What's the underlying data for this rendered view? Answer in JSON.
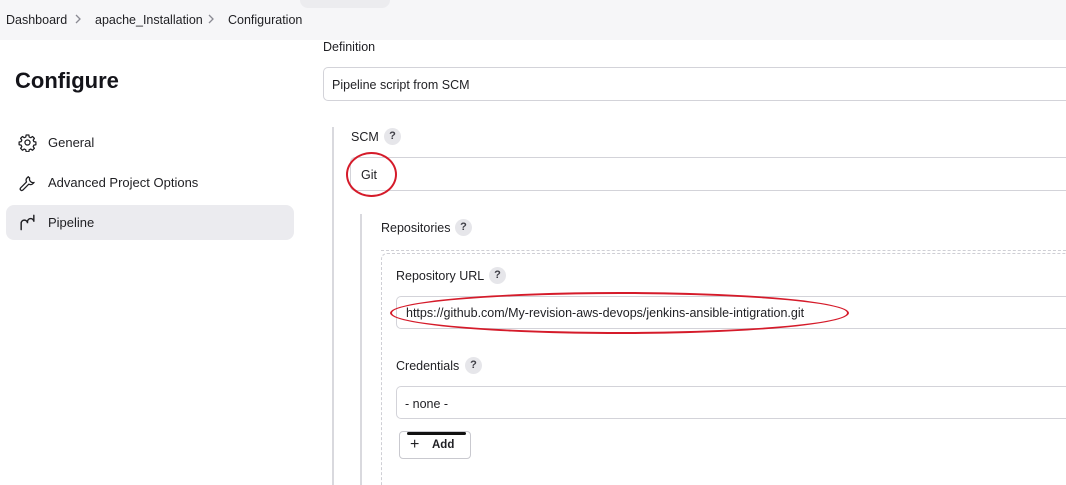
{
  "breadcrumb": {
    "items": [
      "Dashboard",
      "apache_Installation",
      "Configuration"
    ]
  },
  "sidebar": {
    "title": "Configure",
    "items": [
      {
        "label": "General",
        "icon": "gear-icon"
      },
      {
        "label": "Advanced Project Options",
        "icon": "wrench-icon"
      },
      {
        "label": "Pipeline",
        "icon": "pipeline-icon",
        "active": true
      }
    ]
  },
  "definition": {
    "label": "Definition",
    "value": "Pipeline script from SCM"
  },
  "scm": {
    "label": "SCM",
    "help": "?",
    "value": "Git"
  },
  "repositories": {
    "label": "Repositories",
    "help": "?",
    "repository_url": {
      "label": "Repository URL",
      "help": "?",
      "value": "https://github.com/My-revision-aws-devops/jenkins-ansible-intigration.git"
    },
    "credentials": {
      "label": "Credentials",
      "help": "?",
      "value": "- none -"
    },
    "add_button": {
      "label": "Add",
      "icon": "plus-icon"
    }
  },
  "colors": {
    "annotation": "#d51b2a",
    "active_nav": "#ebebef",
    "breadcrumb_bg": "#f6f6f8"
  }
}
